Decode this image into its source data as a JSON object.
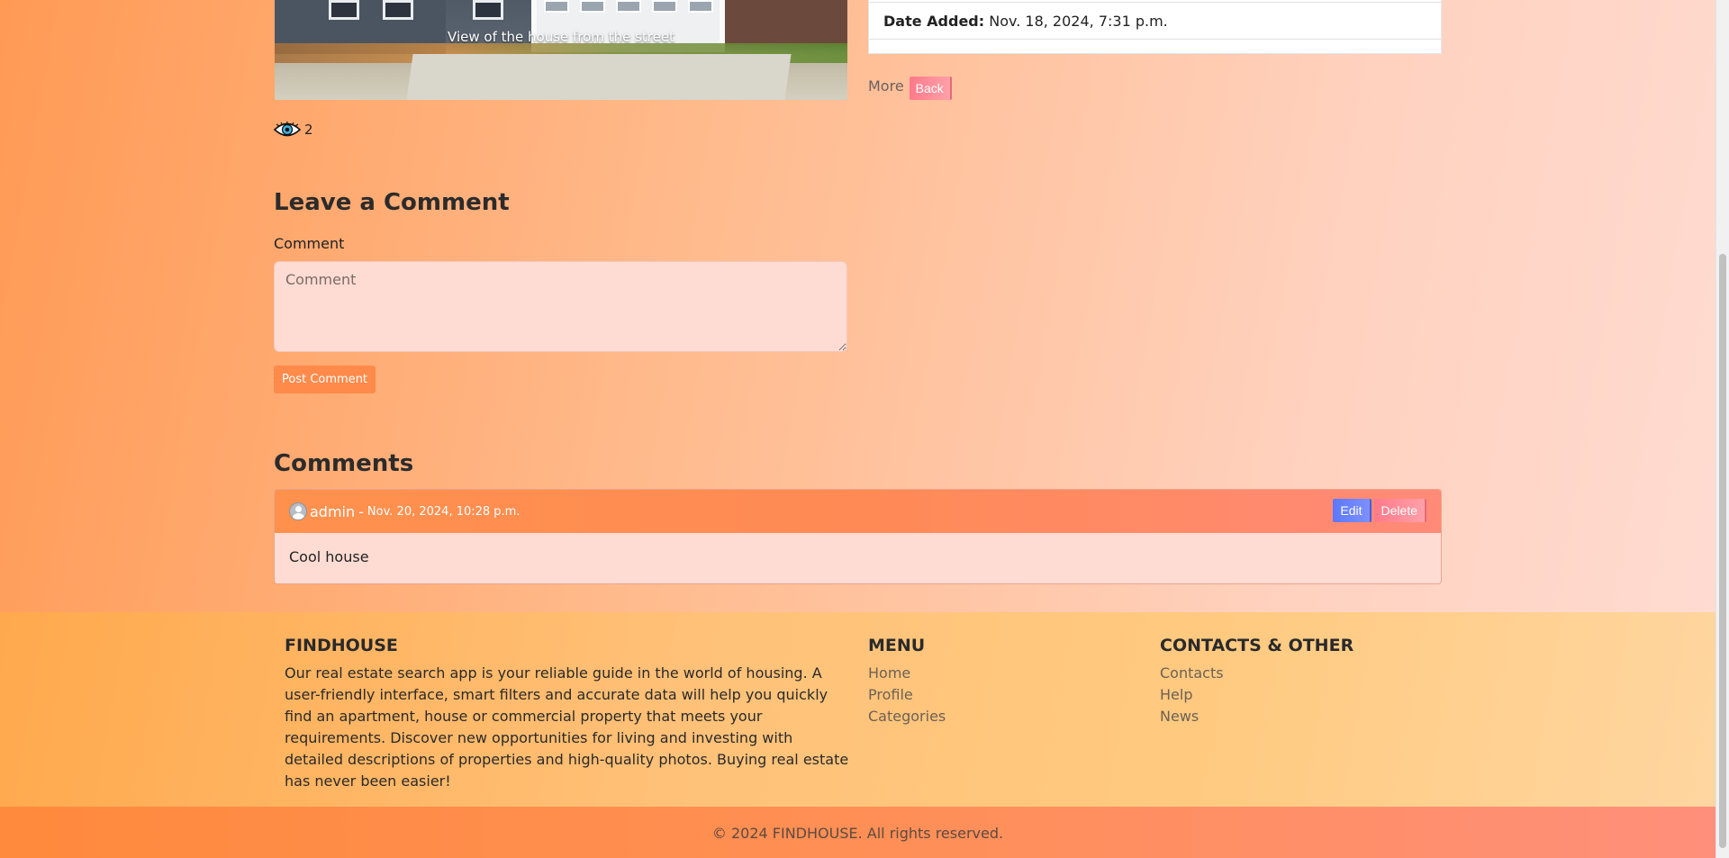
{
  "listing": {
    "image_caption": "View of the house from the street",
    "views_count": "2",
    "details": {
      "date_added_label": "Date Added:",
      "date_added_value": "Nov. 18, 2024, 7:31 p.m."
    },
    "more_label": "More",
    "back_label": "Back"
  },
  "comment_form": {
    "heading": "Leave a Comment",
    "label": "Comment",
    "placeholder": "Comment",
    "submit_label": "Post Comment"
  },
  "comments": {
    "heading": "Comments",
    "items": [
      {
        "author": "admin",
        "separator": "-",
        "date": "Nov. 20, 2024, 10:28 p.m.",
        "text": "Cool house",
        "edit_label": "Edit",
        "delete_label": "Delete"
      }
    ]
  },
  "footer": {
    "brand_title": "FINDHOUSE",
    "brand_text": "Our real estate search app is your reliable guide in the world of housing. A user-friendly interface, smart filters and accurate data will help you quickly find an apartment, house or commercial property that meets your requirements. Discover new opportunities for living and investing with detailed descriptions of properties and high-quality photos. Buying real estate has never been easier!",
    "menu_title": "MENU",
    "menu_items": [
      "Home",
      "Profile",
      "Categories"
    ],
    "contacts_title": "CONTACTS & OTHER",
    "contacts_items": [
      "Contacts",
      "Help",
      "News"
    ],
    "copyright": "© 2024 FINDHOUSE. All rights reserved."
  },
  "colors": {
    "accent_orange": "#ff8a4a",
    "edit_blue": "#5b78ff",
    "delete_pink": "#ff7a8a"
  }
}
